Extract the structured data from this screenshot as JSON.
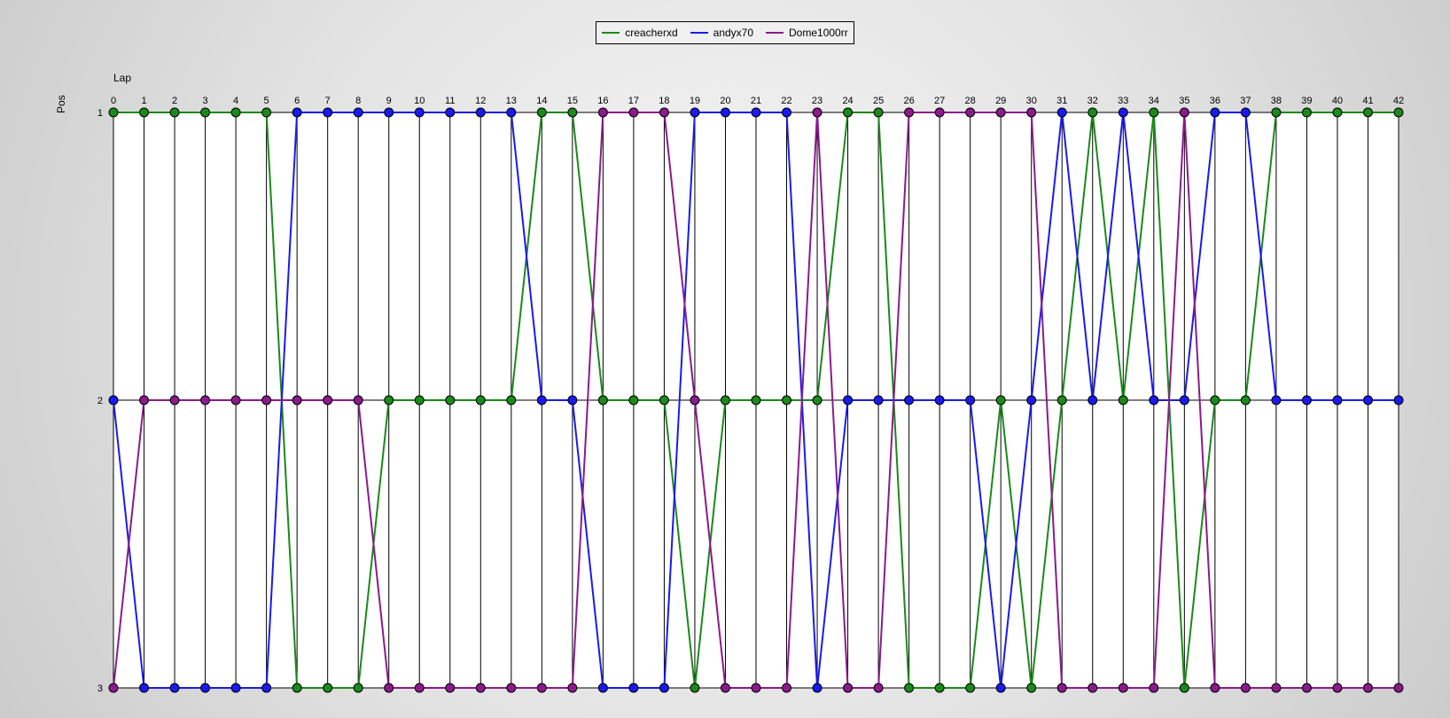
{
  "chart_data": {
    "type": "line",
    "xlabel": "Lap",
    "ylabel": "Pos",
    "x": [
      0,
      1,
      2,
      3,
      4,
      5,
      6,
      7,
      8,
      9,
      10,
      11,
      12,
      13,
      14,
      15,
      16,
      17,
      18,
      19,
      20,
      21,
      22,
      23,
      24,
      25,
      26,
      27,
      28,
      29,
      30,
      31,
      32,
      33,
      34,
      35,
      36,
      37,
      38,
      39,
      40,
      41,
      42
    ],
    "ylim": [
      1,
      3
    ],
    "y_inverted": true,
    "y_ticks": [
      1,
      2,
      3
    ],
    "grid": "vertical",
    "legend_position": "top-center",
    "series": [
      {
        "name": "creacherxd",
        "color": "#1a8a1a",
        "values": [
          1,
          1,
          1,
          1,
          1,
          1,
          3,
          3,
          3,
          2,
          2,
          2,
          2,
          2,
          1,
          1,
          2,
          2,
          2,
          3,
          2,
          2,
          2,
          2,
          1,
          1,
          3,
          3,
          3,
          2,
          3,
          2,
          1,
          2,
          1,
          3,
          2,
          2,
          1,
          1,
          1,
          1,
          1
        ]
      },
      {
        "name": "andyx70",
        "color": "#1a1aee",
        "values": [
          2,
          3,
          3,
          3,
          3,
          3,
          1,
          1,
          1,
          1,
          1,
          1,
          1,
          1,
          2,
          2,
          3,
          3,
          3,
          1,
          1,
          1,
          1,
          3,
          2,
          2,
          2,
          2,
          2,
          3,
          2,
          1,
          2,
          1,
          2,
          2,
          1,
          1,
          2,
          2,
          2,
          2,
          2
        ]
      },
      {
        "name": "Dome1000rr",
        "color": "#8b1a8b",
        "values": [
          3,
          2,
          2,
          2,
          2,
          2,
          2,
          2,
          2,
          3,
          3,
          3,
          3,
          3,
          3,
          3,
          1,
          1,
          1,
          2,
          3,
          3,
          3,
          1,
          3,
          3,
          1,
          1,
          1,
          1,
          1,
          3,
          3,
          3,
          3,
          1,
          3,
          3,
          3,
          3,
          3,
          3,
          3
        ]
      }
    ]
  }
}
